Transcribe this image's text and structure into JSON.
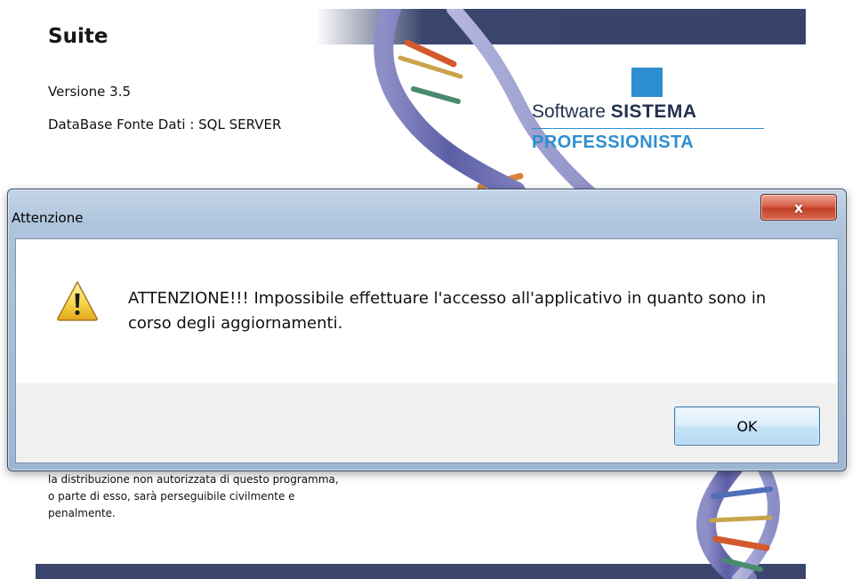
{
  "splash": {
    "app_title": "Suite",
    "version": "Versione 3.5",
    "db_source": "DataBase Fonte Dati : SQL SERVER",
    "logo": {
      "line1_prefix": "Software",
      "line1_strong": "SISTEMA",
      "line2": "PROFESSIONISTA",
      "accent_color": "#2d8fd0",
      "text_color": "#23314f"
    },
    "legal_lines": [
      "la distribuzione non autorizzata di questo programma,",
      "o parte di esso, sarà perseguibile civilmente e",
      "penalmente."
    ],
    "band_color": "#3a456e"
  },
  "dialog": {
    "title": "Attenzione",
    "close_label": "x",
    "icon": "warning-icon",
    "message": "ATTENZIONE!!! Impossibile effettuare l'accesso all'applicativo in quanto sono in corso degli aggiornamenti.",
    "ok_label": "OK"
  }
}
